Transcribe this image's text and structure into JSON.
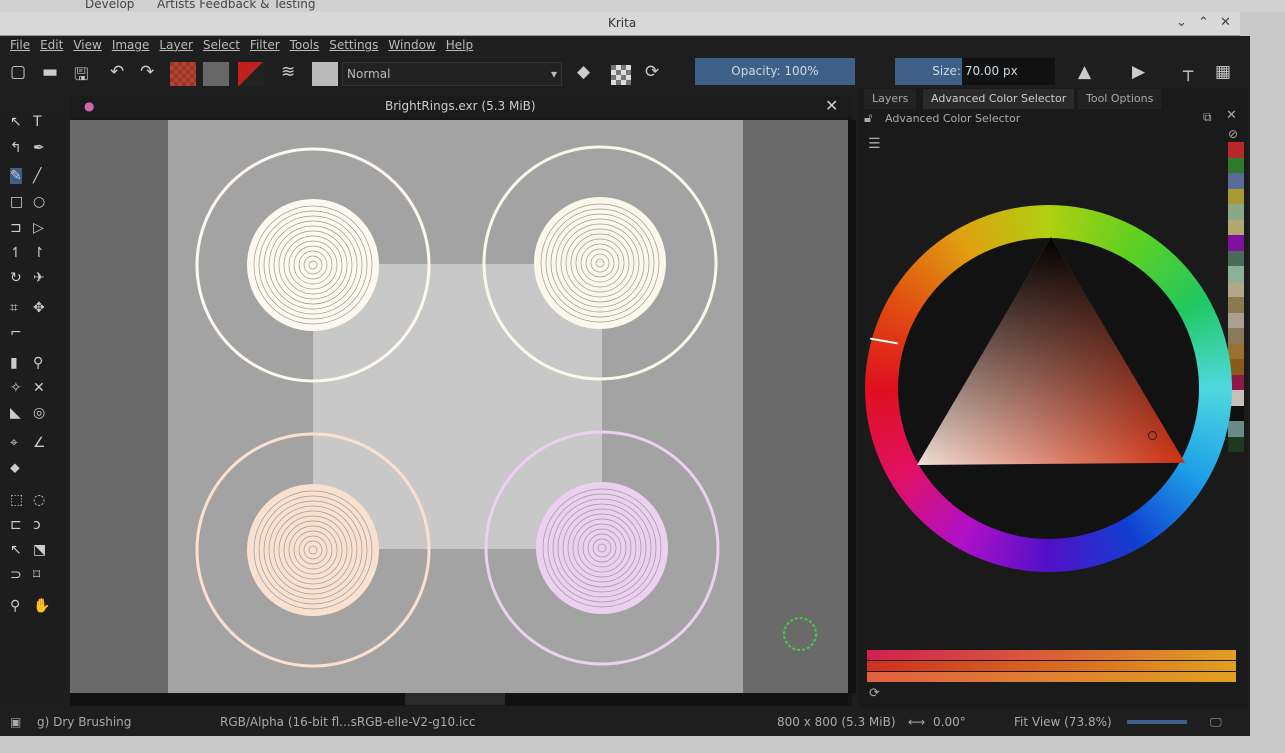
{
  "browser_tabs": [
    "Develop",
    "Artists Feedback & Testing"
  ],
  "window": {
    "title": "Krita"
  },
  "menu": [
    "File",
    "Edit",
    "View",
    "Image",
    "Layer",
    "Select",
    "Filter",
    "Tools",
    "Settings",
    "Window",
    "Help"
  ],
  "toolbar": {
    "blend_mode": "Normal",
    "opacity": "Opacity: 100%",
    "size_label": "Size:",
    "size_value": "70.00 px"
  },
  "document": {
    "title": "BrightRings.exr (5.3 MiB)"
  },
  "docker": {
    "tabs": [
      "Layers",
      "Advanced Color Selector",
      "Tool Options"
    ],
    "active_tab": "Advanced Color Selector",
    "panel_title": "Advanced Color Selector"
  },
  "swatches": [
    "#b8282a",
    "#2e7a28",
    "#5a6a9a",
    "#a89a30",
    "#8aa888",
    "#b0a870",
    "#8010a0",
    "#4a6a5a",
    "#8ab098",
    "#b0a88a",
    "#8a7a50",
    "#a8a090",
    "#8a7a5a",
    "#9a7030",
    "#8a5a18",
    "#901848",
    "#c8c0b8",
    "#101010",
    "#6a8a88",
    "#1e3a1e"
  ],
  "color_sliders": [
    {
      "color": "#d02050"
    },
    {
      "color": "#d03020"
    },
    {
      "color": "#e06040"
    }
  ],
  "status": {
    "brush": "g) Dry Brushing",
    "colorspace": "RGB/Alpha (16-bit fl...sRGB-elle-V2-g10.icc",
    "dimensions": "800 x 800 (5.3 MiB)",
    "rotation": "0.00°",
    "zoom": "Fit View (73.8%)"
  },
  "colors": {
    "accent": "#3e5f88",
    "background": "#1e1e1e"
  }
}
